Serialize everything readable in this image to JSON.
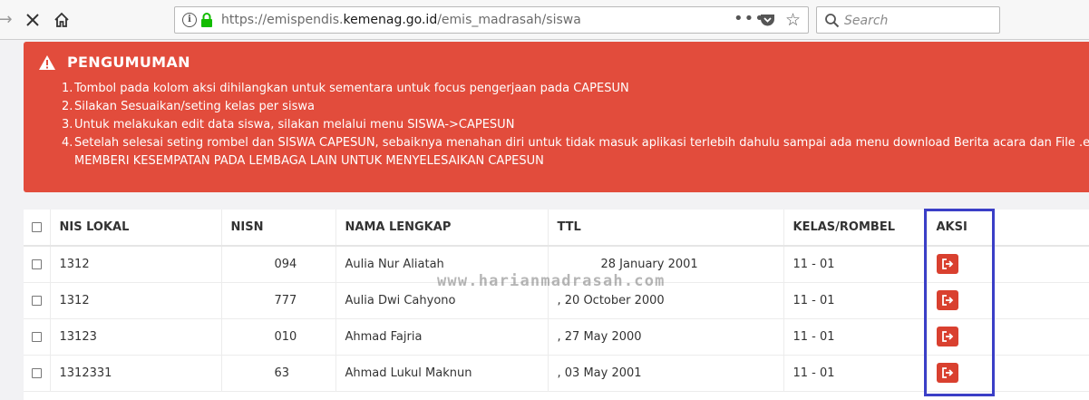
{
  "browser": {
    "url_prefix": "https://emispendis.",
    "url_domain": "kemenag.go.id",
    "url_path": "/emis_madrasah/siswa",
    "search_placeholder": "Search",
    "more_label": "•••"
  },
  "announcement": {
    "title": "PENGUMUMAN",
    "items": [
      {
        "num": "1.",
        "text": "Tombol pada kolom aksi dihilangkan untuk sementara untuk focus pengerjaan pada CAPESUN"
      },
      {
        "num": "2.",
        "text": "Silakan Sesuaikan/seting kelas per siswa"
      },
      {
        "num": "3.",
        "text": "Untuk melakukan edit data siswa, silakan melalui menu SISWA->CAPESUN"
      },
      {
        "num": "4.",
        "text": "Setelah selesai seting rombel dan SISWA CAPESUN, sebaiknya menahan diri untuk tidak masuk aplikasi terlebih dahulu sampai ada menu download Berita acara dan File .ez dan",
        "cont": "MEMBERI KESEMPATAN PADA LEMBAGA LAIN UNTUK MENYELESAIKAN CAPESUN"
      }
    ]
  },
  "table": {
    "headers": {
      "nis": "NIS LOKAL",
      "nisn": "NISN",
      "nama": "NAMA LENGKAP",
      "ttl": "TTL",
      "kelas": "KELAS/ROMBEL",
      "aksi": "AKSI"
    },
    "rows": [
      {
        "nis": "1312",
        "nisn": "094",
        "nama": "Aulia Nur Aliatah",
        "ttl": "28 January 2001",
        "kelas": "11 - 01"
      },
      {
        "nis": "1312",
        "nisn": "777",
        "nama": "Aulia Dwi Cahyono",
        "ttl": ", 20 October 2000",
        "kelas": "11 - 01"
      },
      {
        "nis": "13123",
        "nisn": "010",
        "nama": "Ahmad Fajria",
        "ttl": ", 27 May 2000",
        "kelas": "11 - 01"
      },
      {
        "nis": "1312331",
        "nisn": "63",
        "nama": "Ahmad Lukul Maknun",
        "ttl": ", 03 May 2001",
        "kelas": "11 - 01"
      }
    ]
  },
  "watermark": "www.harianmadrasah.com",
  "colors": {
    "alert_bg": "#e24c3c",
    "action_button": "#d9402f",
    "highlight_box": "#3b3fc7"
  }
}
